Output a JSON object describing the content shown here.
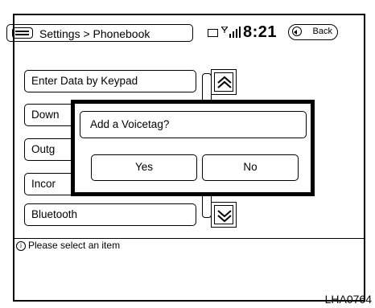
{
  "header": {
    "title": "Settings > Phonebook",
    "clock": "8:21",
    "back_label": "Back"
  },
  "menu": {
    "items": [
      {
        "label": "Enter Data by Keypad"
      },
      {
        "label": "Down"
      },
      {
        "label": "Outg"
      },
      {
        "label": "Incor"
      },
      {
        "label": "Bluetooth"
      }
    ]
  },
  "dialog": {
    "message": "Add a Voicetag?",
    "yes_label": "Yes",
    "no_label": "No"
  },
  "status": {
    "text": "Please select an item",
    "info_symbol": "i"
  },
  "figure_code": "LHA0764"
}
